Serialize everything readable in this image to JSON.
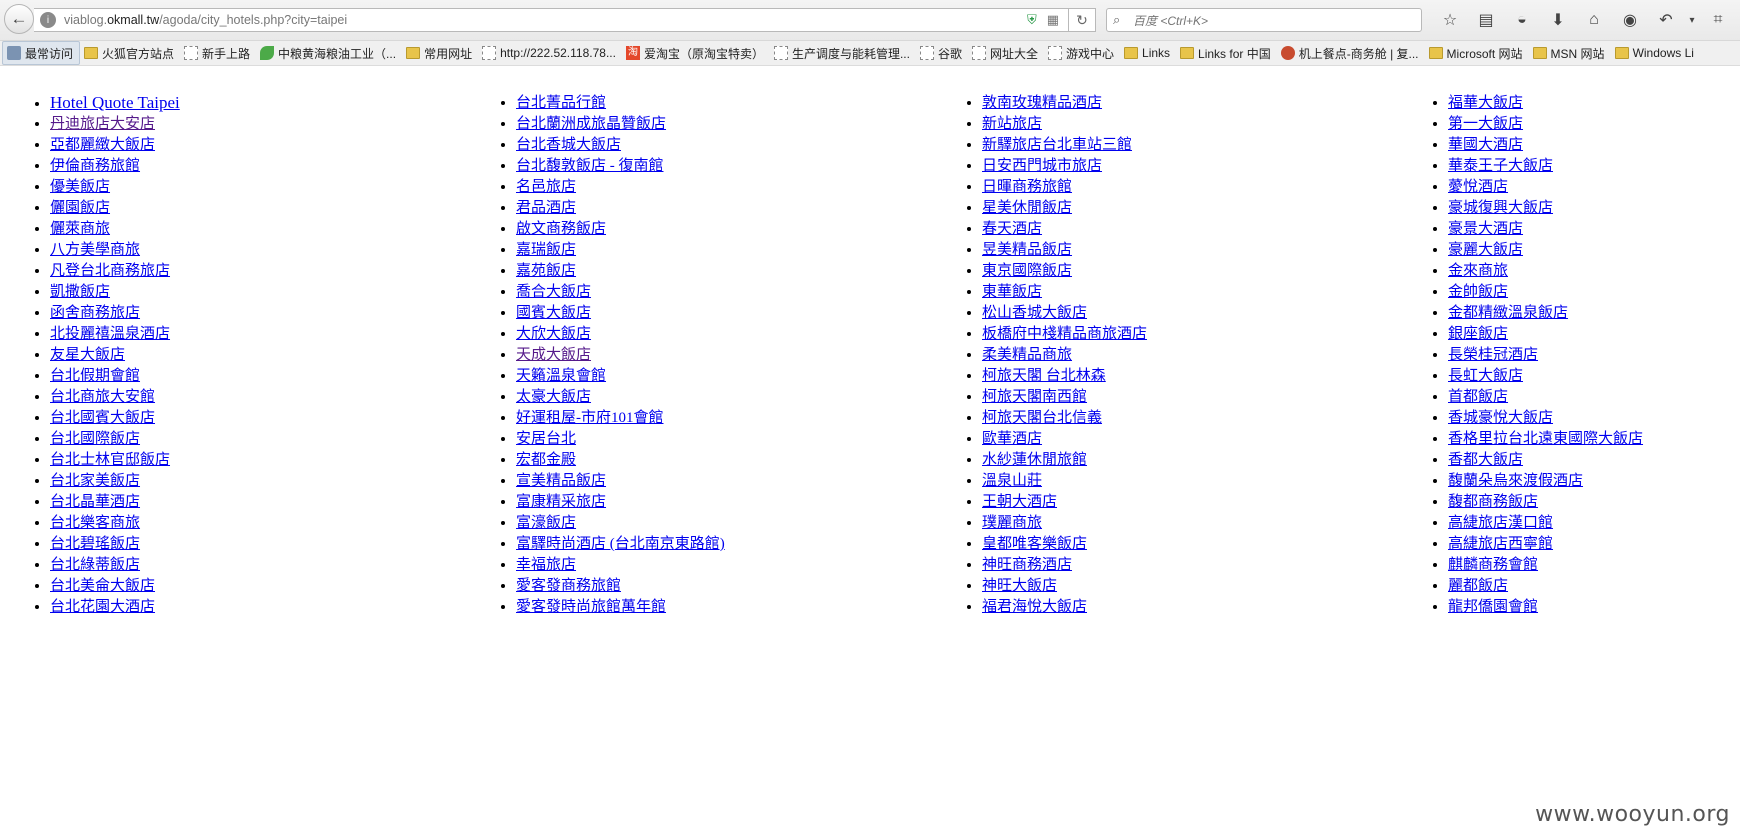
{
  "browser": {
    "url_prefix": "viablog.",
    "url_domain": "okmall.tw",
    "url_path": "/agoda/city_hotels.php?city=taipei",
    "search_placeholder": "百度 <Ctrl+K>",
    "icons": {
      "back": "back-arrow-icon",
      "site": "globe-icon",
      "reload": "reload-icon",
      "search": "search-icon"
    }
  },
  "bookmarks": [
    {
      "label": "最常访问",
      "icon": "gear"
    },
    {
      "label": "火狐官方站点",
      "icon": "folder"
    },
    {
      "label": "新手上路",
      "icon": "page"
    },
    {
      "label": "中粮黄海粮油工业（...",
      "icon": "leaf"
    },
    {
      "label": "常用网址",
      "icon": "folder"
    },
    {
      "label": "http://222.52.118.78...",
      "icon": "page"
    },
    {
      "label": "爱淘宝（原淘宝特卖）",
      "icon": "taobao"
    },
    {
      "label": "生产调度与能耗管理...",
      "icon": "page"
    },
    {
      "label": "谷歌",
      "icon": "page"
    },
    {
      "label": "网址大全",
      "icon": "page"
    },
    {
      "label": "游戏中心",
      "icon": "page"
    },
    {
      "label": "Links",
      "icon": "folder"
    },
    {
      "label": "Links for 中国",
      "icon": "folder"
    },
    {
      "label": "机上餐点-商务舱 | 复...",
      "icon": "plane"
    },
    {
      "label": "Microsoft 网站",
      "icon": "folder"
    },
    {
      "label": "MSN 网站",
      "icon": "folder"
    },
    {
      "label": "Windows Li",
      "icon": "folder"
    }
  ],
  "columns": [
    [
      {
        "label": "Hotel Quote Taipei",
        "title": true
      },
      {
        "label": "丹迪旅店大安店",
        "visited": true
      },
      {
        "label": "亞都麗緻大飯店"
      },
      {
        "label": "伊倫商務旅館"
      },
      {
        "label": "優美飯店"
      },
      {
        "label": "儷園飯店"
      },
      {
        "label": "儷萊商旅"
      },
      {
        "label": "八方美學商旅"
      },
      {
        "label": "凡登台北商務旅店"
      },
      {
        "label": "凱撒飯店"
      },
      {
        "label": "函舍商務旅店"
      },
      {
        "label": "北投麗禧溫泉酒店"
      },
      {
        "label": "友星大飯店"
      },
      {
        "label": "台北假期會館"
      },
      {
        "label": "台北商旅大安館"
      },
      {
        "label": "台北國賓大飯店"
      },
      {
        "label": "台北國際飯店"
      },
      {
        "label": "台北士林官邸飯店"
      },
      {
        "label": "台北家美飯店"
      },
      {
        "label": "台北晶華酒店"
      },
      {
        "label": "台北樂客商旅"
      },
      {
        "label": "台北碧瑤飯店"
      },
      {
        "label": "台北綠蒂飯店"
      },
      {
        "label": "台北美侖大飯店"
      },
      {
        "label": "台北花園大酒店"
      }
    ],
    [
      {
        "label": "台北菁品行館"
      },
      {
        "label": "台北蘭洲成旅晶贊飯店"
      },
      {
        "label": "台北香城大飯店"
      },
      {
        "label": "台北馥敦飯店 - 復南館"
      },
      {
        "label": "名邑旅店"
      },
      {
        "label": "君品酒店"
      },
      {
        "label": "啟文商務飯店"
      },
      {
        "label": "嘉瑞飯店"
      },
      {
        "label": "嘉苑飯店"
      },
      {
        "label": "喬合大飯店"
      },
      {
        "label": "國賓大飯店"
      },
      {
        "label": "大欣大飯店"
      },
      {
        "label": "天成大飯店",
        "visited": true
      },
      {
        "label": "天籟溫泉會館"
      },
      {
        "label": "太豪大飯店"
      },
      {
        "label": "好運租屋-市府101會館"
      },
      {
        "label": "安居台北"
      },
      {
        "label": "宏都金殿"
      },
      {
        "label": "宣美精品飯店"
      },
      {
        "label": "富康精采旅店"
      },
      {
        "label": "富濠飯店"
      },
      {
        "label": "富驛時尚酒店 (台北南京東路館)"
      },
      {
        "label": "幸福旅店"
      },
      {
        "label": "愛客發商務旅館"
      },
      {
        "label": "愛客發時尚旅館萬年館"
      }
    ],
    [
      {
        "label": "敦南玫瑰精品酒店"
      },
      {
        "label": "新站旅店"
      },
      {
        "label": "新驛旅店台北車站三館"
      },
      {
        "label": "日安西門城市旅店"
      },
      {
        "label": "日暉商務旅館"
      },
      {
        "label": "星美休閒飯店"
      },
      {
        "label": "春天酒店"
      },
      {
        "label": "昱美精品飯店"
      },
      {
        "label": "東京國際飯店"
      },
      {
        "label": "東華飯店"
      },
      {
        "label": "松山香城大飯店"
      },
      {
        "label": "板橋府中棧精品商旅酒店"
      },
      {
        "label": "柔美精品商旅"
      },
      {
        "label": "柯旅天閣 台北林森"
      },
      {
        "label": "柯旅天閣南西館"
      },
      {
        "label": "柯旅天閣台北信義"
      },
      {
        "label": "歐華酒店"
      },
      {
        "label": "水紗蓮休閒旅館"
      },
      {
        "label": "溫泉山莊"
      },
      {
        "label": "王朝大酒店"
      },
      {
        "label": "璞麗商旅"
      },
      {
        "label": "皇都唯客樂飯店"
      },
      {
        "label": "神旺商務酒店"
      },
      {
        "label": "神旺大飯店"
      },
      {
        "label": "福君海悅大飯店"
      }
    ],
    [
      {
        "label": "福華大飯店"
      },
      {
        "label": "第一大飯店"
      },
      {
        "label": "華國大酒店"
      },
      {
        "label": "華泰王子大飯店"
      },
      {
        "label": "薆悅酒店"
      },
      {
        "label": "豪城復興大飯店"
      },
      {
        "label": "豪景大酒店"
      },
      {
        "label": "豪麗大飯店"
      },
      {
        "label": "金來商旅"
      },
      {
        "label": "金帥飯店"
      },
      {
        "label": "金都精緻溫泉飯店"
      },
      {
        "label": "銀座飯店"
      },
      {
        "label": "長榮桂冠酒店"
      },
      {
        "label": "長虹大飯店"
      },
      {
        "label": "首都飯店"
      },
      {
        "label": "香城豪悅大飯店"
      },
      {
        "label": "香格里拉台北遠東國際大飯店"
      },
      {
        "label": "香都大飯店"
      },
      {
        "label": "馥蘭朵烏來渡假酒店"
      },
      {
        "label": "馥都商務飯店"
      },
      {
        "label": "高緁旅店漢口館"
      },
      {
        "label": "高緁旅店西寧館"
      },
      {
        "label": "麒麟商務會館"
      },
      {
        "label": "麗都飯店"
      },
      {
        "label": "龍邦僑園會館"
      }
    ]
  ],
  "watermark": "www.wooyun.org"
}
